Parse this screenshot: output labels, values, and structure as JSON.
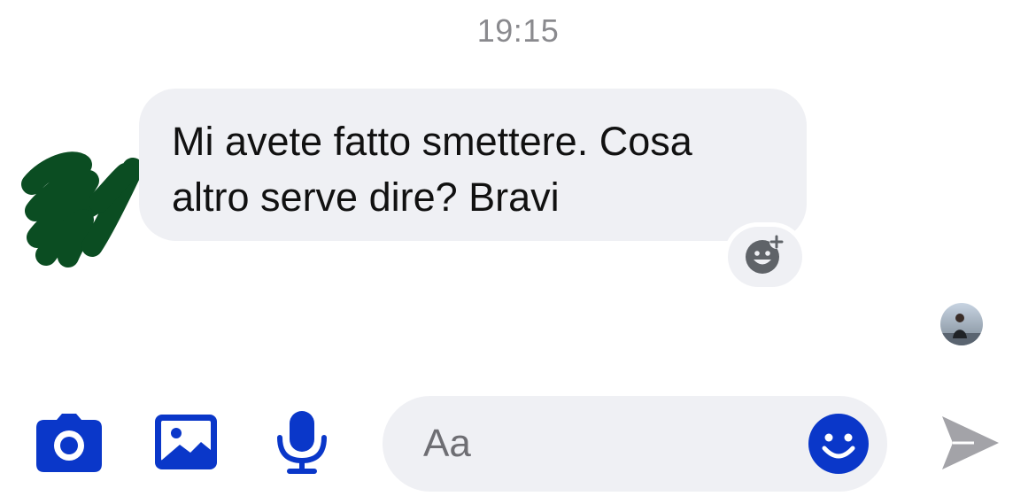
{
  "thread": {
    "timestamp": "19:15"
  },
  "message": {
    "text": "Mi avete fatto smettere. Cosa altro serve dire? Bravi",
    "sender_avatar_icon": "redacted-avatar-scribble",
    "reaction_icon": "add-reaction-icon"
  },
  "seen_indicator": {
    "icon": "seen-avatar-photo"
  },
  "composer": {
    "placeholder": "Aa",
    "value": "",
    "icons": {
      "camera": "camera-icon",
      "gallery": "image-gallery-icon",
      "mic": "microphone-icon",
      "emoji": "emoji-icon",
      "send": "send-icon"
    }
  },
  "colors": {
    "accent": "#0a37c9",
    "bubble": "#eff0f4",
    "timestamp": "#8a8a8e",
    "redaction": "#0b4d22",
    "send_inactive": "#a3a3a8",
    "reaction_icon": "#5f6368"
  }
}
